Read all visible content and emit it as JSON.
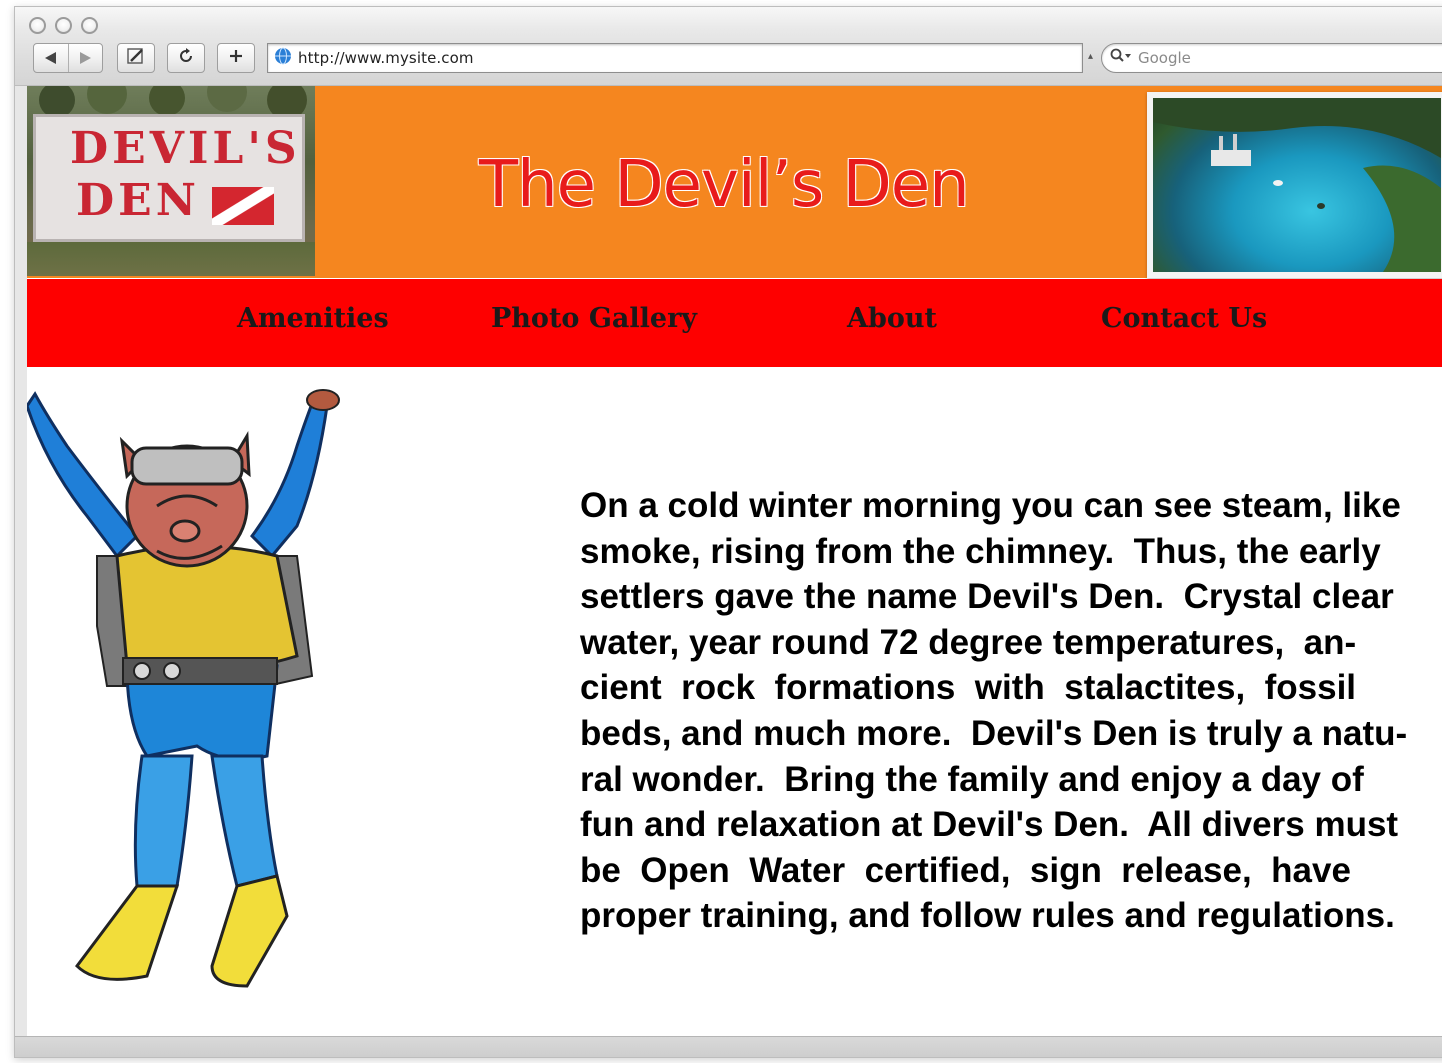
{
  "browser": {
    "url": "http://www.mysite.com",
    "search_placeholder": "Google",
    "icons": {
      "back": "back-arrow-icon",
      "forward": "forward-arrow-icon",
      "bookmark": "pencil-icon",
      "reload": "reload-icon",
      "add": "plus-icon",
      "site": "globe-icon",
      "search": "magnifier-icon"
    }
  },
  "header": {
    "title": "The Devil’s Den",
    "sign_line1": "DEVIL'S",
    "sign_line2": "DEN"
  },
  "nav": {
    "items": [
      {
        "label": "Amenities"
      },
      {
        "label": "Photo Gallery"
      },
      {
        "label": "About"
      },
      {
        "label": "Contact Us"
      }
    ]
  },
  "main": {
    "paragraph": "On a cold winter morning you can see steam, like\nsmoke, rising from the chimney.  Thus, the early\nsettlers gave the name Devil's Den.  Crystal clear\nwater, year round 72 degree temperatures,  an-\ncient  rock  formations  with  stalactites,  fossil\nbeds, and much more.  Devil's Den is truly a natu-\nral wonder.  Bring the family and enjoy a day of\nfun and relaxation at Devil's Den.  All divers must\nbe  Open  Water  certified,  sign  release,  have\nproper training, and follow rules and regulations."
  },
  "colors": {
    "banner": "#f5861f",
    "navbar": "#fe0000",
    "title": "#e81b1b"
  }
}
